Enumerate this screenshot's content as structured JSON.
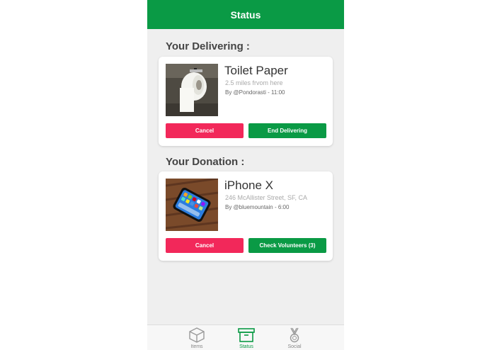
{
  "header": {
    "title": "Status"
  },
  "delivering": {
    "section_title": "Your Delivering :",
    "item": {
      "title": "Toilet Paper",
      "subtitle": "2.5 miles frvom here",
      "by": "By @Pondorasti - 11:00",
      "image_icon": "toilet-paper-photo"
    },
    "cancel_label": "Cancel",
    "action_label": "End Delivering"
  },
  "donation": {
    "section_title": "Your Donation :",
    "item": {
      "title": "iPhone X",
      "subtitle": "246 McAllister Street, SF, CA",
      "by": "By @bluemountain - 6:00",
      "image_icon": "iphone-photo"
    },
    "cancel_label": "Cancel",
    "action_label": "Check Volunteers (3)"
  },
  "tabbar": {
    "tabs": [
      {
        "label": "Items",
        "icon": "box-icon",
        "active": false
      },
      {
        "label": "Status",
        "icon": "archive-icon",
        "active": true
      },
      {
        "label": "Social",
        "icon": "medal-icon",
        "active": false
      }
    ]
  },
  "colors": {
    "accent_green": "#0a9a45",
    "cancel_red": "#f2285a",
    "background": "#efefef"
  }
}
